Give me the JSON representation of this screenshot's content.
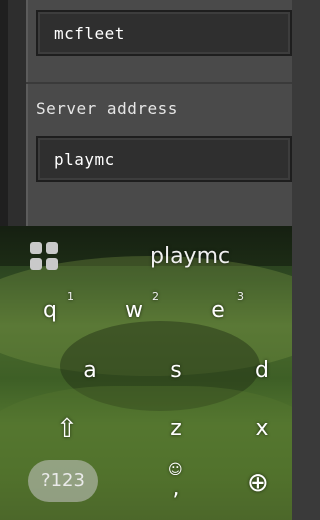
{
  "form": {
    "server_name_value": "mcfleet",
    "server_address_label": "Server address",
    "server_address_value": "playmc"
  },
  "keyboard": {
    "suggestion": "playmc",
    "row1": [
      {
        "key": "q",
        "sup": "1"
      },
      {
        "key": "w",
        "sup": "2"
      },
      {
        "key": "e",
        "sup": "3"
      }
    ],
    "row2": [
      "a",
      "s",
      "d"
    ],
    "row3": [
      "z",
      "x"
    ],
    "symbols_key": "?123",
    "comma_key": ",",
    "emoji_glyph": "☺",
    "shift_glyph": "⇧",
    "globe_glyph": "⊕"
  }
}
